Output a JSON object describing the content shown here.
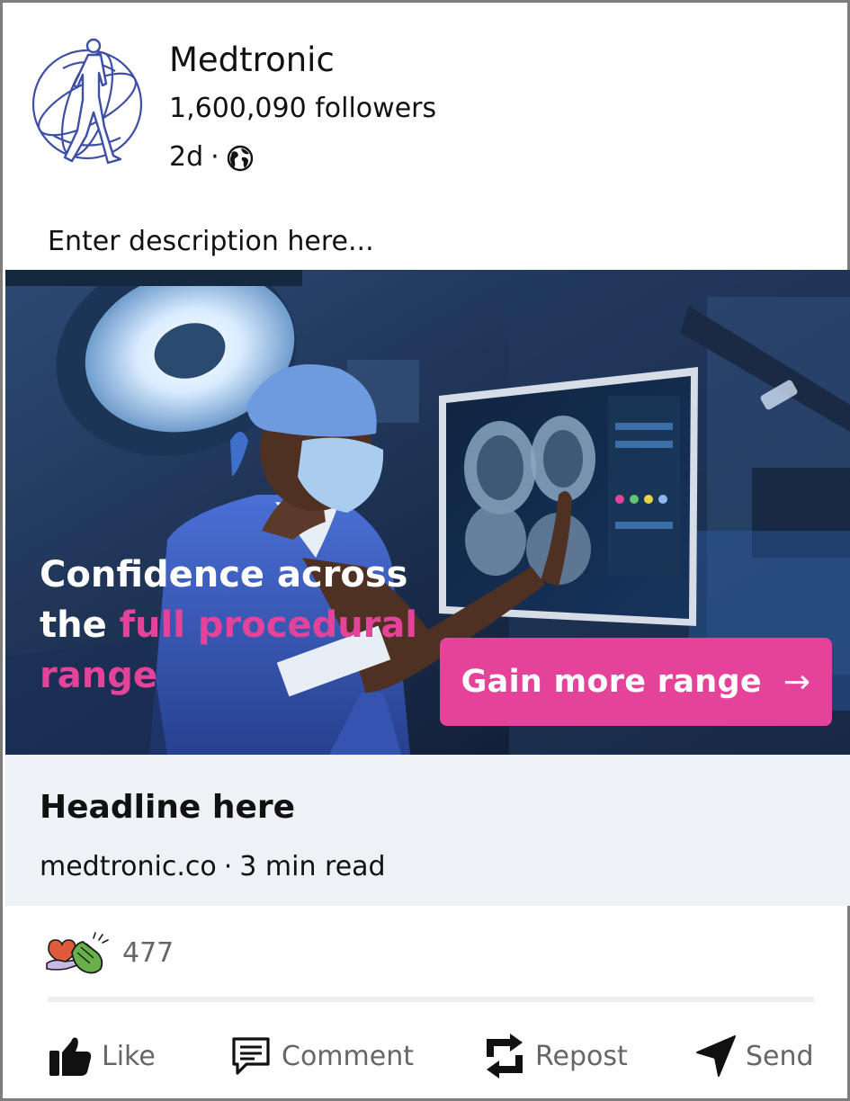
{
  "header": {
    "company": "Medtronic",
    "followers": "1,600,090 followers",
    "age": "2d",
    "separator": "·",
    "visibility_icon": "globe-icon"
  },
  "post": {
    "description": "Enter description here..."
  },
  "hero": {
    "line1": "Confidence across",
    "line2_start": "the ",
    "line2_highlight": "full procedural",
    "line3_highlight": "range",
    "cta_label": "Gain more range",
    "cta_arrow": "→",
    "highlight_color": "#e5439a"
  },
  "preview": {
    "headline": "Headline here",
    "domain": "medtronic.co",
    "separator": "·",
    "read_time": "3 min read"
  },
  "social": {
    "reaction_count": "477",
    "reaction_icons": [
      "love-icon",
      "clap-icon"
    ]
  },
  "actions": {
    "like": "Like",
    "comment": "Comment",
    "repost": "Repost",
    "send": "Send"
  }
}
